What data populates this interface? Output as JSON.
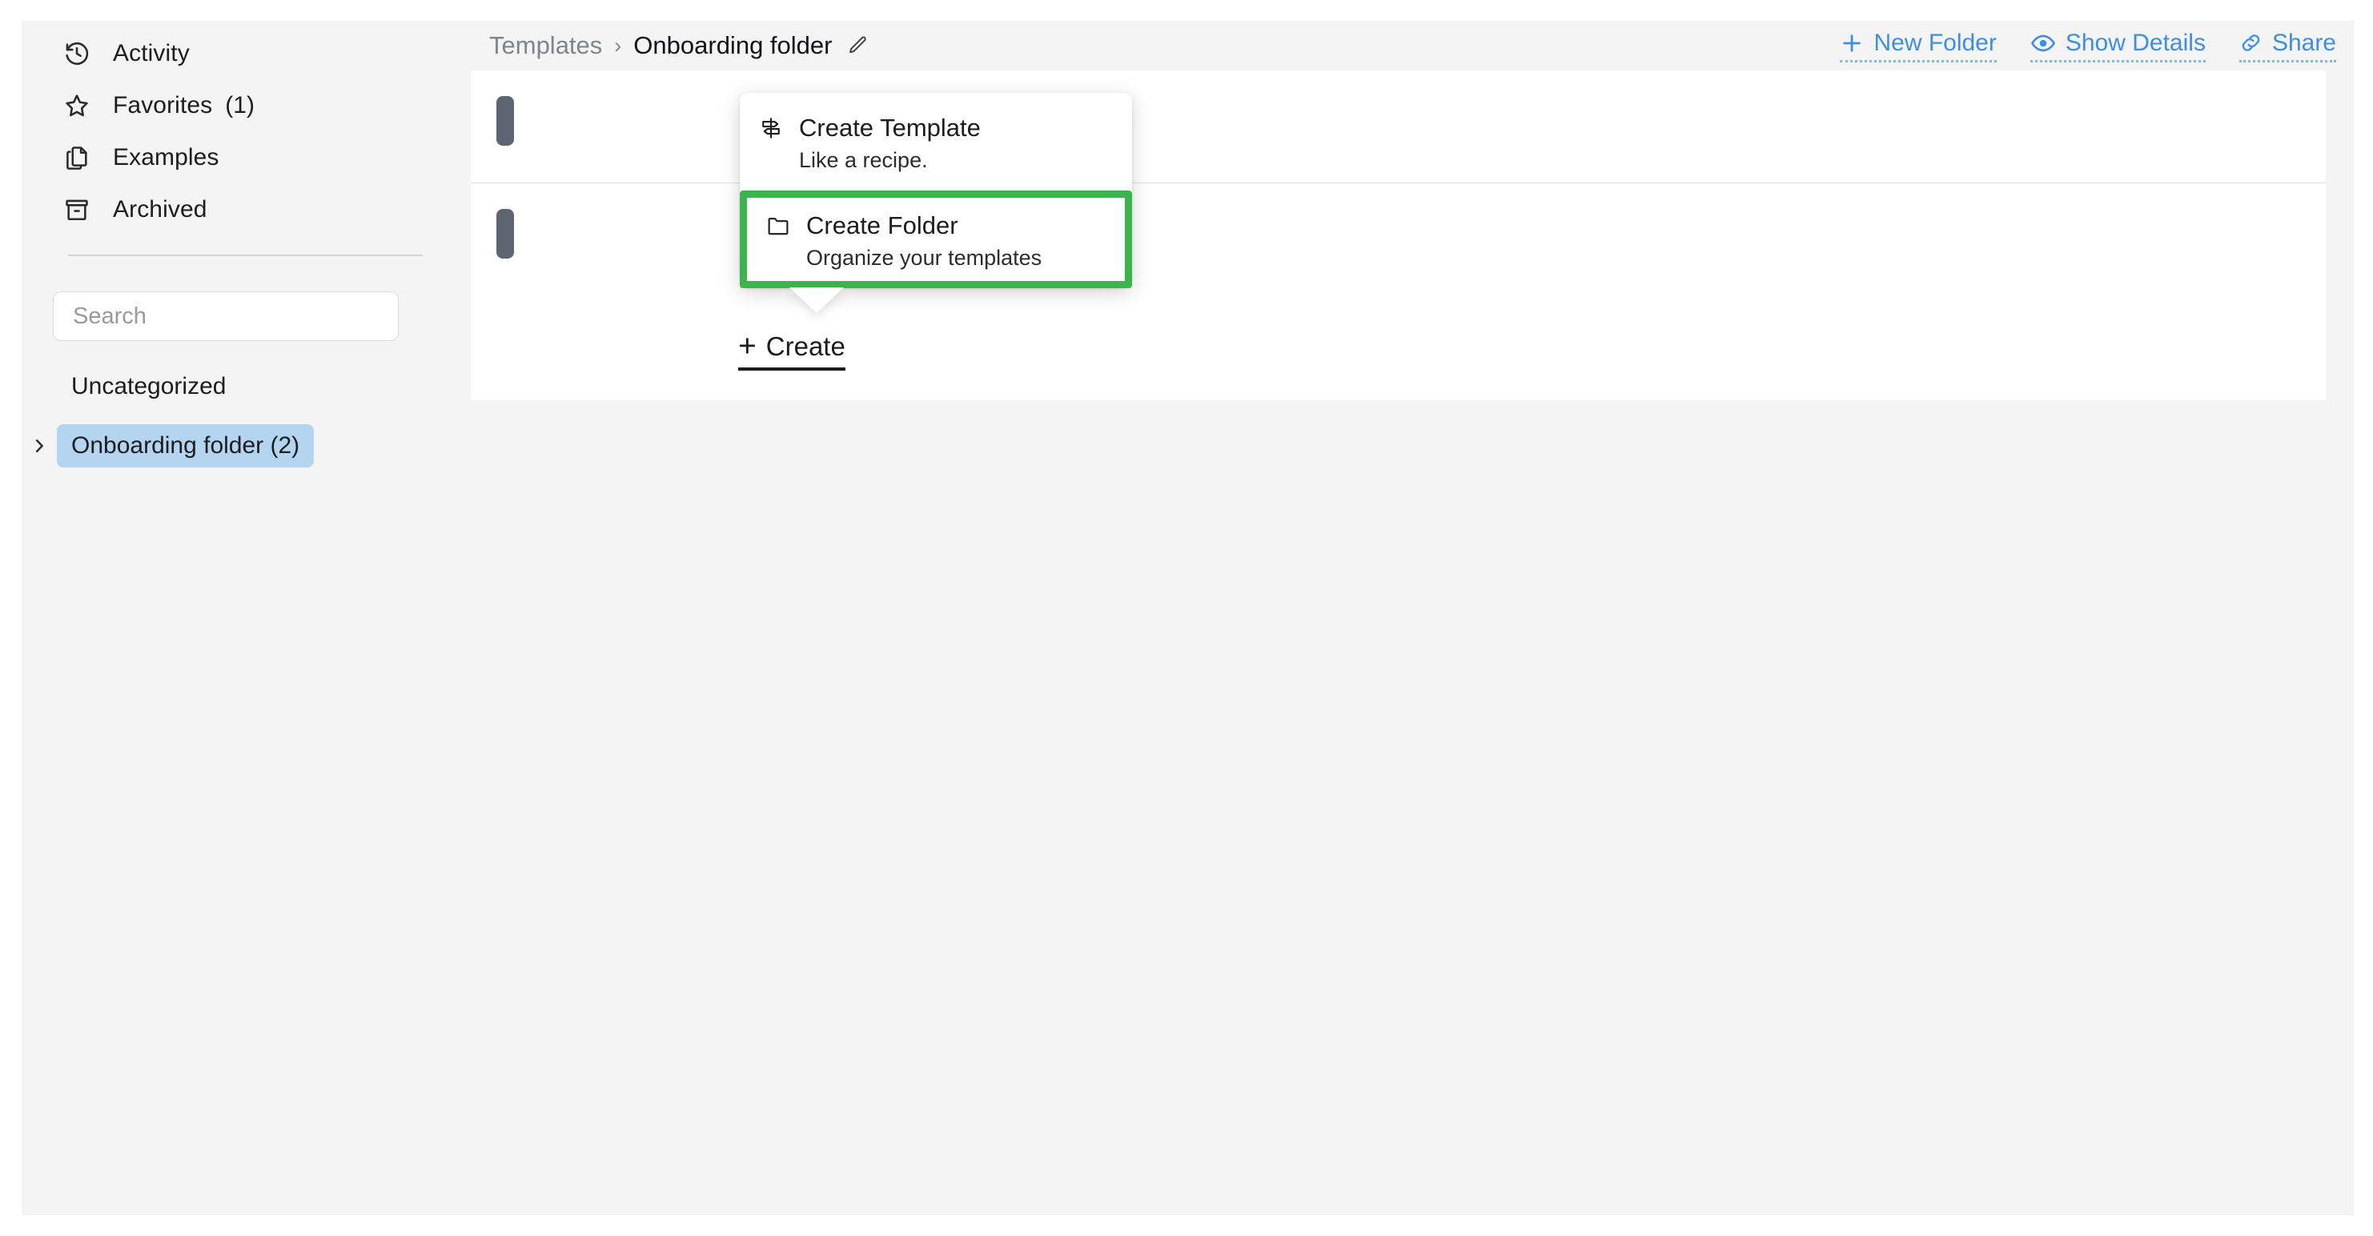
{
  "sidebar": {
    "nav_items": [
      {
        "label": "Activity",
        "icon": "history-icon",
        "count": ""
      },
      {
        "label": "Favorites",
        "icon": "star-icon",
        "count": "(1)"
      },
      {
        "label": "Examples",
        "icon": "copy-icon",
        "count": ""
      },
      {
        "label": "Archived",
        "icon": "archive-icon",
        "count": ""
      }
    ],
    "search": {
      "value": "",
      "placeholder": "Search"
    },
    "folders": [
      {
        "label": "Uncategorized",
        "selected": false,
        "has_chevron": false
      },
      {
        "label": "Onboarding folder (2)",
        "selected": true,
        "has_chevron": true
      }
    ]
  },
  "header": {
    "breadcrumb": {
      "parent": "Templates",
      "separator": "›",
      "current": "Onboarding folder",
      "edit_icon": "pencil-icon"
    },
    "actions": [
      {
        "label": "New Folder",
        "icon": "plus-icon"
      },
      {
        "label": "Show Details",
        "icon": "eye-icon"
      },
      {
        "label": "Share",
        "icon": "link-icon"
      }
    ]
  },
  "main": {
    "create_button": {
      "plus": "+",
      "label": "Create"
    },
    "rows": [
      {
        "handle": "drag-handle"
      },
      {
        "handle": "drag-handle"
      }
    ]
  },
  "popup": {
    "items": [
      {
        "title": "Create Template",
        "subtitle": "Like a recipe.",
        "icon": "signpost-icon",
        "highlighted": false
      },
      {
        "title": "Create Folder",
        "subtitle": "Organize your templates",
        "icon": "folder-icon",
        "highlighted": true
      }
    ]
  },
  "colors": {
    "page_background": "#f4f4f4",
    "panel_background": "#ffffff",
    "accent_link": "#3e8ee4",
    "selected_folder": "#b4d5f0",
    "highlight_border": "#3cb44d",
    "drag_handle": "#5d6572",
    "breadcrumb_muted": "#7e858e",
    "text_primary": "#1d1d1f"
  }
}
